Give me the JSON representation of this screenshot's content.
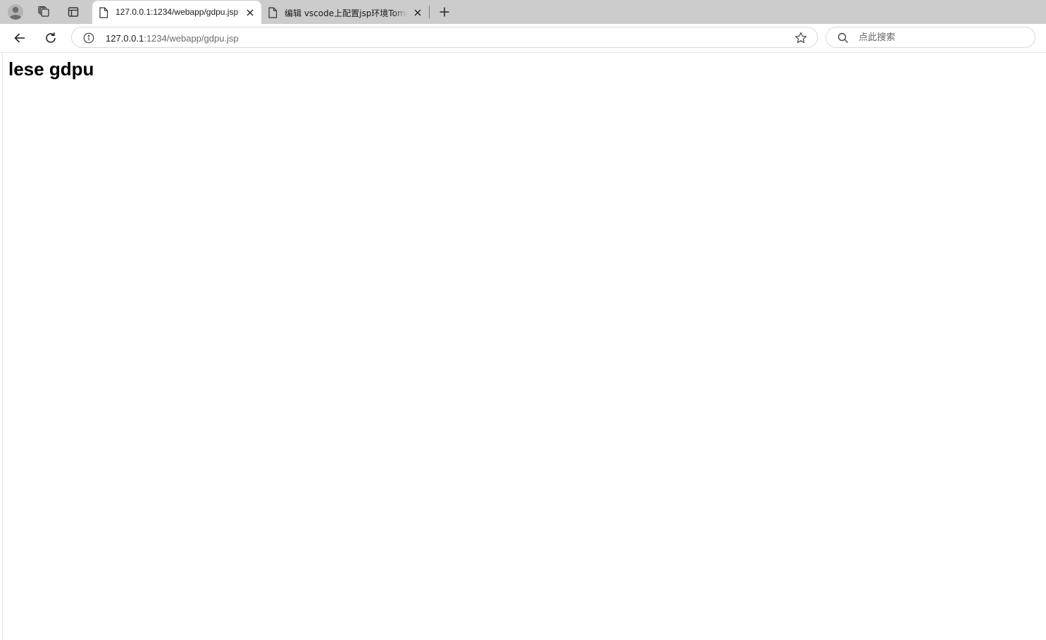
{
  "tabstrip": {
    "profile_icon": "profile-avatar-icon",
    "collections_icon": "collections-icon",
    "tab_actions_icon": "tab-actions-icon",
    "tabs": [
      {
        "title": "127.0.0.1:1234/webapp/gdpu.jsp",
        "active": true,
        "icon": "document-icon"
      },
      {
        "title": "编辑 vscode上配置jsp环境Tomcat",
        "active": false,
        "icon": "document-icon"
      }
    ],
    "new_tab_icon": "plus-icon"
  },
  "toolbar": {
    "back_icon": "back-arrow-icon",
    "refresh_icon": "refresh-icon",
    "address": {
      "host": "127.0.0.1",
      "rest": ":1234/webapp/gdpu.jsp",
      "info_icon": "info-icon",
      "favorite_icon": "star-icon"
    },
    "search": {
      "placeholder": "点此搜索",
      "value": "",
      "icon": "search-icon"
    }
  },
  "page": {
    "heading": "lese gdpu"
  },
  "colors": {
    "tabstrip_bg": "#cccccc",
    "active_tab_bg": "#ffffff",
    "page_bg": "#ffffff",
    "text": "#1a1a1a",
    "url_muted": "#6b6b6b"
  }
}
